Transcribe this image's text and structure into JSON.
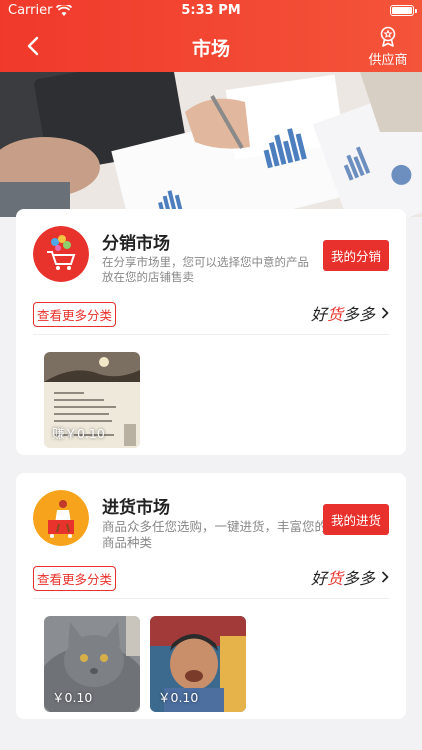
{
  "status": {
    "carrier": "Carrier",
    "time": "5:33 PM"
  },
  "nav": {
    "title": "市场",
    "supplier": "供应商"
  },
  "distribution": {
    "title": "分销市场",
    "desc": "在分享市场里，您可以选择您中意的产品放在您的店铺售卖",
    "my_button": "我的分销",
    "more_button": "查看更多分类",
    "slogan_a": "好",
    "slogan_b": "货",
    "slogan_c": "多多",
    "products": [
      {
        "price": "赚￥0.10"
      }
    ]
  },
  "purchase": {
    "title": "进货市场",
    "desc": "商品众多任您选购，一键进货，丰富您的商品种类",
    "my_button": "我的进货",
    "more_button": "查看更多分类",
    "slogan_a": "好",
    "slogan_b": "货",
    "slogan_c": "多多",
    "products": [
      {
        "price": "￥0.10"
      },
      {
        "price": "￥0.10"
      }
    ]
  },
  "colors": {
    "accent": "#e8312c",
    "header": "#f0392b"
  }
}
